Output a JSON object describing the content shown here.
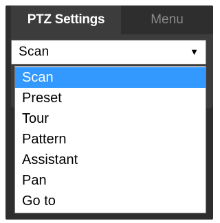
{
  "tabs": {
    "ptz_label": "PTZ Settings",
    "menu_label": "Menu"
  },
  "select": {
    "value": "Scan",
    "arrow": "▼"
  },
  "options": [
    "Scan",
    "Preset",
    "Tour",
    "Pattern",
    "Assistant",
    "Pan",
    "Go to"
  ],
  "colors": {
    "panel": "#2e2e2e",
    "active_tab": "#3c3c3c",
    "highlight": "#3399ff"
  }
}
